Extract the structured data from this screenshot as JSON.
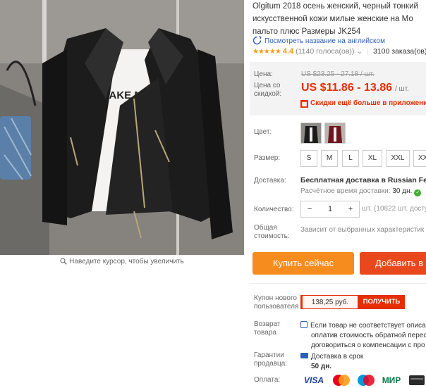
{
  "product": {
    "title_lines": [
      "Olgitum 2018 осень женский, черный тонкий",
      "искусственной кожи милые женские на Мо",
      "пальто плюс Размеры JK254"
    ],
    "translate_link": "Посмотреть название на английском",
    "rating": {
      "stars": "★★★★★",
      "value": "4.4",
      "votes": "(1140 голоса(ов))",
      "orders": "3100 заказа(ов)"
    },
    "image_hint": "Наведите курсор, чтобы увеличить",
    "shirt_text": "MAKE MIS"
  },
  "price": {
    "label": "Цена:",
    "old": "US $23.25 - 27.18 / шт.",
    "discount_label": "Цена со скидкой:",
    "current": "US $11.86 - 13.86",
    "unit": "/ шт.",
    "promo": "Скидки ещё больше в приложении"
  },
  "options": {
    "color_label": "Цвет:",
    "size_label": "Размер:",
    "sizes": [
      "S",
      "M",
      "L",
      "XL",
      "XXL",
      "XX"
    ]
  },
  "shipping": {
    "label": "Доставка:",
    "text": "Бесплатная доставка в Russian Fede",
    "time_label": "Расчётное время доставки:",
    "time_value": "30 дн."
  },
  "quantity": {
    "label": "Количество:",
    "value": "1",
    "minus": "−",
    "plus": "+",
    "info": "шт. (10822 шт. доступ"
  },
  "total": {
    "label_line1": "Общая",
    "label_line2": "стоимость:",
    "text": "Зависит от выбранных характеристик"
  },
  "actions": {
    "buy": "Купить сейчас",
    "cart": "Добавить в"
  },
  "coupon": {
    "label_line1": "Купон нового",
    "label_line2": "пользователя",
    "amount": "138,25 руб.",
    "button": "ПОЛУЧИТЬ"
  },
  "returns": {
    "label_line1": "Возврат",
    "label_line2": "товара",
    "lines": [
      "Если товар не соответствует описа",
      "оплатив стоимость обратной перес",
      "договориться о компенсации с про"
    ]
  },
  "guarantee": {
    "label_line1": "Гарантии",
    "label_line2": "продавца:",
    "line1": "Доставка в срок",
    "line2": "50 дн."
  },
  "payment": {
    "label": "Оплата:",
    "methods": [
      "VISA",
      "MasterCard",
      "Maestro",
      "МИР"
    ]
  },
  "colors": {
    "accent": "#e62e04",
    "buy": "#f68c1e",
    "cart": "#e8481c",
    "link": "#2d5fb8",
    "star": "#f39c12"
  }
}
